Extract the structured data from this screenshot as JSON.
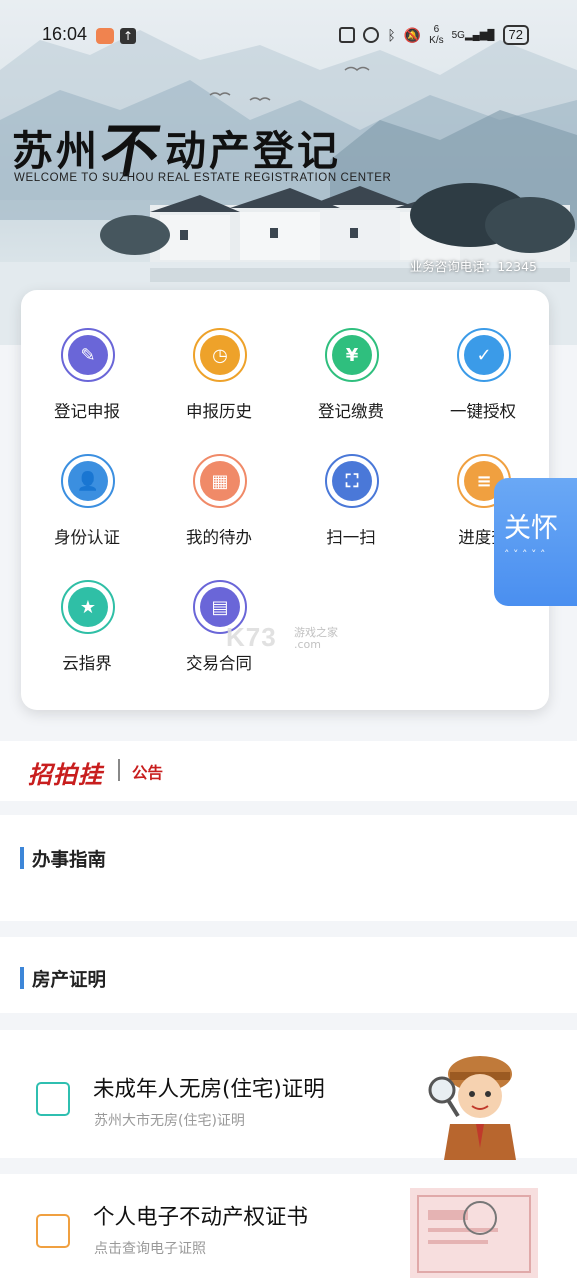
{
  "status_bar": {
    "time": "16:04",
    "net_speed_top": "6",
    "net_speed_unit": "K/s",
    "signal": "5G",
    "battery": "72"
  },
  "header": {
    "title_pre": "苏州",
    "title_brush": "不",
    "title_post": "动产登记",
    "subtitle": "WELCOME TO SUZHOU REAL ESTATE REGISTRATION CENTER",
    "hotline": "业务咨询电话：12345"
  },
  "services": [
    {
      "label": "登记申报",
      "icon": "edit-document-icon",
      "color": "#6a66d8"
    },
    {
      "label": "申报历史",
      "icon": "history-document-icon",
      "color": "#eea22a"
    },
    {
      "label": "登记缴费",
      "icon": "money-bag-icon",
      "color": "#2fbf7e"
    },
    {
      "label": "一键授权",
      "icon": "shield-check-icon",
      "color": "#3b9be8"
    },
    {
      "label": "身份认证",
      "icon": "user-verify-icon",
      "color": "#3b8fe0"
    },
    {
      "label": "我的待办",
      "icon": "grid-tasks-icon",
      "color": "#f08a68"
    },
    {
      "label": "扫一扫",
      "icon": "scan-icon",
      "color": "#4a78d8"
    },
    {
      "label": "进度查",
      "icon": "progress-search-icon",
      "color": "#f0a040"
    },
    {
      "label": "云指界",
      "icon": "book-star-icon",
      "color": "#2fbfa6"
    },
    {
      "label": "交易合同",
      "icon": "contract-icon",
      "color": "#6a66d8"
    }
  ],
  "care_tab": {
    "label": "关怀"
  },
  "watermark": {
    "main": "K73",
    "sub": "游戏之家",
    "domain": ".com"
  },
  "notice": {
    "brand": "招拍挂",
    "tag": "公告"
  },
  "sections": {
    "guide_title": "办事指南",
    "proof_title": "房产证明"
  },
  "certs": [
    {
      "title": "未成年人无房(住宅)证明",
      "subtitle": "苏州大市无房(住宅)证明",
      "icon": "search-document-icon",
      "color": "#2fbfb0"
    },
    {
      "title": "个人电子不动产权证书",
      "subtitle": "点击查询电子证照",
      "icon": "certificate-icon",
      "color": "#f0a040"
    }
  ]
}
